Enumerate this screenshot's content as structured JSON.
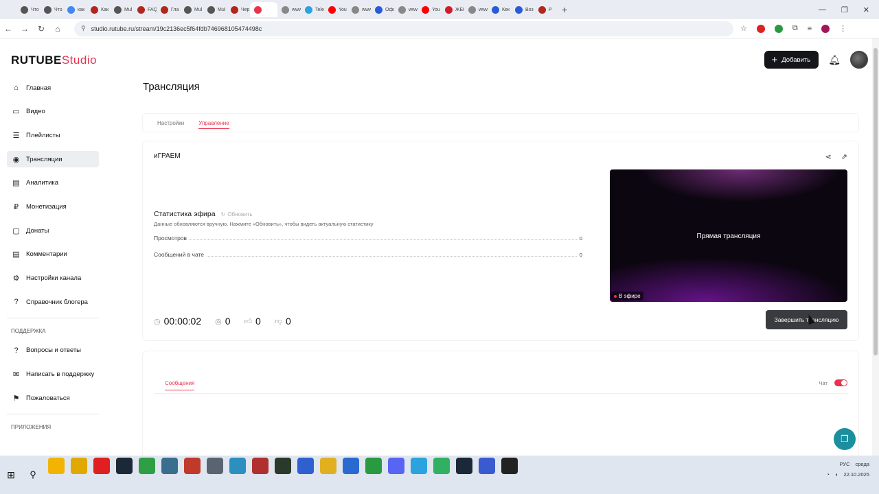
{
  "browser": {
    "tabs": [
      {
        "label": "Что",
        "color": "#555555"
      },
      {
        "label": "Что",
        "color": "#555555"
      },
      {
        "label": "как",
        "color": "#4285f4"
      },
      {
        "label": "Как",
        "color": "#b3261e"
      },
      {
        "label": "Mul",
        "color": "#555555"
      },
      {
        "label": "FAQ",
        "color": "#b3261e"
      },
      {
        "label": "Гла",
        "color": "#b3261e"
      },
      {
        "label": "Mul",
        "color": "#555555"
      },
      {
        "label": "Mul",
        "color": "#555555"
      },
      {
        "label": "Чер",
        "color": "#b3261e"
      },
      {
        "label": "",
        "color": "#e8344e",
        "active": true
      },
      {
        "label": "www",
        "color": "#888888"
      },
      {
        "label": "Tele",
        "color": "#2aa3df"
      },
      {
        "label": "You",
        "color": "#ff0000"
      },
      {
        "label": "www",
        "color": "#888888"
      },
      {
        "label": "Офс",
        "color": "#2a5bd7"
      },
      {
        "label": "www",
        "color": "#888888"
      },
      {
        "label": "You",
        "color": "#ff0000"
      },
      {
        "label": "ЖЕС",
        "color": "#d11a2a"
      },
      {
        "label": "www",
        "color": "#888888"
      },
      {
        "label": "Кек",
        "color": "#2a5bd7"
      },
      {
        "label": "Воз",
        "color": "#2a5bd7"
      },
      {
        "label": "P",
        "color": "#b3261e"
      }
    ],
    "new_tab": "+",
    "window_controls": {
      "minimize": "—",
      "restore": "❐",
      "close": "✕"
    },
    "url": "studio.rutube.ru/stream/19c2136ec5f64fdb74696810547449​8c"
  },
  "app": {
    "logo_main": "RUTUBE",
    "logo_studio": "Studio",
    "add_button": "Добавить",
    "page_title": "Трансляция",
    "tabs": [
      "Настройки",
      "Управление"
    ],
    "active_tab": "Управление"
  },
  "sidebar": {
    "items": [
      {
        "label": "Главная",
        "icon": "home-icon",
        "glyph": "⌂"
      },
      {
        "label": "Видео",
        "icon": "video-icon",
        "glyph": "▭"
      },
      {
        "label": "Плейлисты",
        "icon": "playlist-icon",
        "glyph": "☰"
      },
      {
        "label": "Трансляции",
        "icon": "broadcast-icon",
        "glyph": "◉",
        "active": true
      },
      {
        "label": "Аналитика",
        "icon": "analytics-icon",
        "glyph": "▤"
      },
      {
        "label": "Монетизация",
        "icon": "money-icon",
        "glyph": "₽"
      },
      {
        "label": "Донаты",
        "icon": "donate-icon",
        "glyph": "▢"
      },
      {
        "label": "Комментарии",
        "icon": "comments-icon",
        "glyph": "▤"
      },
      {
        "label": "Настройки канала",
        "icon": "gear-icon",
        "glyph": "⚙"
      },
      {
        "label": "Справочник блогера",
        "icon": "help-icon",
        "glyph": "?"
      }
    ],
    "support_heading": "ПОДДЕРЖКА",
    "support_items": [
      {
        "label": "Вопросы и ответы",
        "icon": "faq-icon",
        "glyph": "?"
      },
      {
        "label": "Написать в поддержку",
        "icon": "mail-icon",
        "glyph": "✉"
      },
      {
        "label": "Пожаловаться",
        "icon": "flag-icon",
        "glyph": "⚑"
      }
    ],
    "apps_heading": "ПРИЛОЖЕНИЯ"
  },
  "stream": {
    "name": "иГРАЕМ",
    "stats_title": "Статистика эфира",
    "refresh_label": "Обновить",
    "stats_note": "Данные обновляются вручную. Нажмите «Обновить», чтобы видеть актуальную статистику",
    "stats": [
      {
        "label": "Просмотров",
        "value": "0"
      },
      {
        "label": "Сообщений в чате",
        "value": "0"
      }
    ],
    "timer": "00:00:02",
    "viewers": "0",
    "likes": "0",
    "dislikes": "0",
    "preview_label": "Прямая трансляция",
    "live_badge": "В эфире",
    "end_button": "Завершить трансляцию"
  },
  "chat": {
    "tab_label": "Сообщения",
    "toggle_label": "Чат",
    "toggle_on": true
  },
  "taskbar": {
    "apps": [
      {
        "icon": "calendar-icon",
        "color": "#f2b400"
      },
      {
        "icon": "folder-icon",
        "color": "#e0a800"
      },
      {
        "icon": "yandex-icon",
        "color": "#e02020"
      },
      {
        "icon": "steam-icon",
        "color": "#1b2838"
      },
      {
        "icon": "chrome-icon",
        "color": "#2f9e44"
      },
      {
        "icon": "app-icon",
        "color": "#3a6e8f"
      },
      {
        "icon": "app-icon",
        "color": "#c0392b"
      },
      {
        "icon": "gear-icon",
        "color": "#5a6470"
      },
      {
        "icon": "app-icon",
        "color": "#2d8fc0"
      },
      {
        "icon": "app-icon",
        "color": "#b03030"
      },
      {
        "icon": "app-icon",
        "color": "#2a3a2a"
      },
      {
        "icon": "app-icon",
        "color": "#3060d0"
      },
      {
        "icon": "app-icon",
        "color": "#e0b020"
      },
      {
        "icon": "app-icon",
        "color": "#2a6ad0"
      },
      {
        "icon": "app-icon",
        "color": "#2a9a40"
      },
      {
        "icon": "discord-icon",
        "color": "#5865f2"
      },
      {
        "icon": "telegram-icon",
        "color": "#2aa3df"
      },
      {
        "icon": "app-icon",
        "color": "#30b060"
      },
      {
        "icon": "steam-icon",
        "color": "#1b2838"
      },
      {
        "icon": "app-icon",
        "color": "#3a5ad0"
      },
      {
        "icon": "obs-icon",
        "color": "#222222"
      }
    ],
    "tray_lang": "РУС",
    "tray_day": "среда",
    "tray_date": "22.10.2025"
  },
  "colors": {
    "accent": "#e8344e",
    "dark_button": "#15161a",
    "fab": "#1b8f9e"
  }
}
